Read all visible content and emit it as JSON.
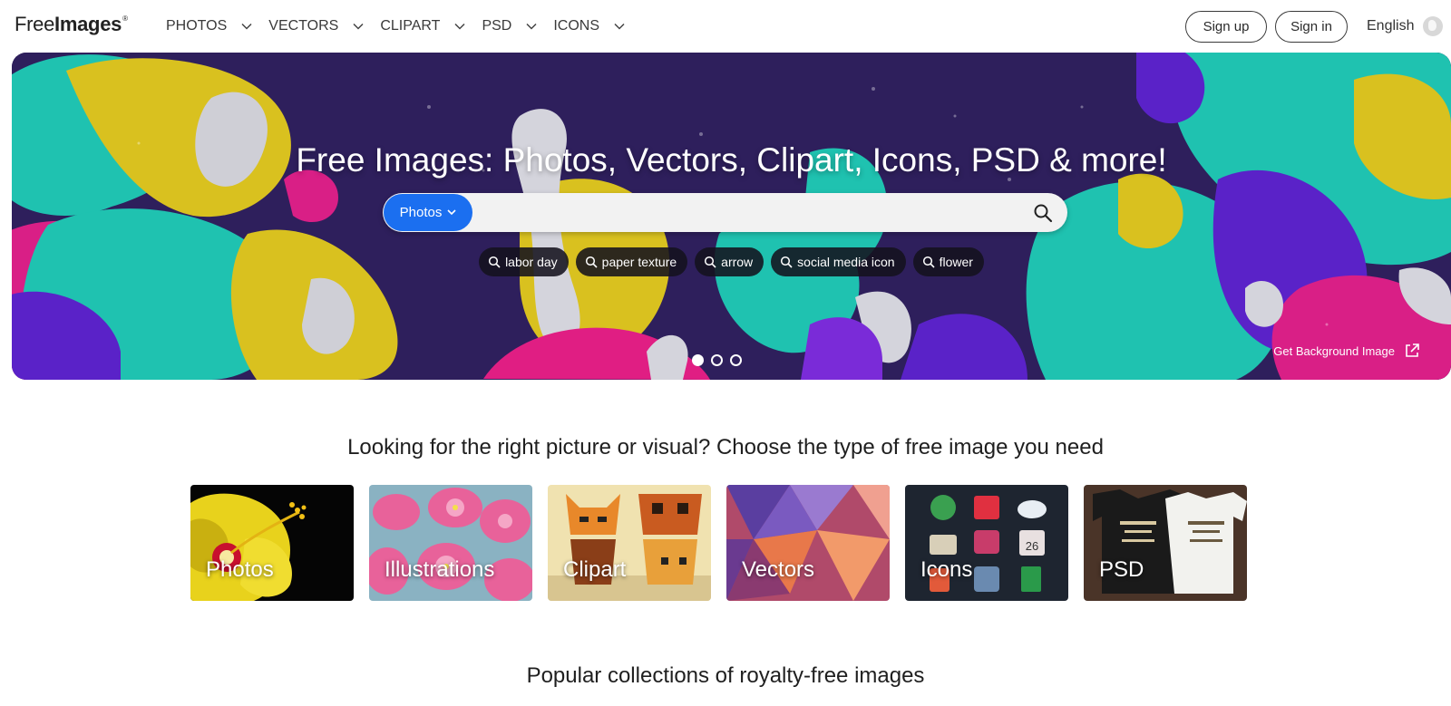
{
  "header": {
    "logo_regular": "Free",
    "logo_bold": "Images",
    "logo_mark": "®",
    "nav": [
      {
        "label": "PHOTOS"
      },
      {
        "label": "VECTORS"
      },
      {
        "label": "CLIPART"
      },
      {
        "label": "PSD"
      },
      {
        "label": "ICONS"
      }
    ],
    "signup_label": "Sign up",
    "signin_label": "Sign in",
    "language": "English"
  },
  "hero": {
    "title": "Free Images: Photos, Vectors, Clipart, Icons, PSD & more!",
    "search": {
      "type_label": "Photos",
      "placeholder": "",
      "value": ""
    },
    "tags": [
      {
        "label": "labor day"
      },
      {
        "label": "paper texture"
      },
      {
        "label": "arrow"
      },
      {
        "label": "social media icon"
      },
      {
        "label": "flower"
      }
    ],
    "carousel": {
      "count": 3,
      "active_index": 0
    },
    "background_link": "Get Background Image"
  },
  "categories": {
    "title": "Looking for the right picture or visual? Choose the type of free image you need",
    "items": [
      {
        "label": "Photos"
      },
      {
        "label": "Illustrations"
      },
      {
        "label": "Clipart"
      },
      {
        "label": "Vectors"
      },
      {
        "label": "Icons"
      },
      {
        "label": "PSD"
      }
    ]
  },
  "collections": {
    "title": "Popular collections of royalty-free images"
  },
  "colors": {
    "accent": "#1b6ff0",
    "hero_bg": "#2e1f5c",
    "teal": "#1fc2b0",
    "magenta": "#d91f86",
    "yellow": "#d9c11f",
    "purple": "#5a22c8"
  },
  "icons": [
    "chevron-down-icon",
    "search-icon",
    "globe-icon",
    "external-link-icon"
  ]
}
